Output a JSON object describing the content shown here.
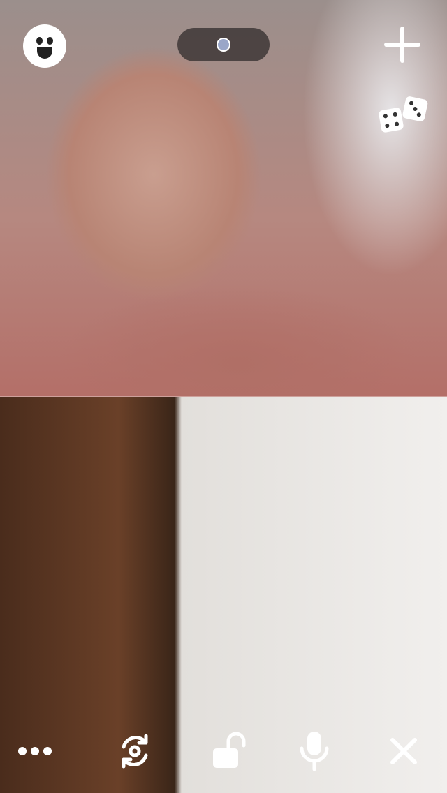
{
  "call": {
    "remote_label": "",
    "local_label": ""
  },
  "top_controls": {
    "face_icon": "emoji-face-icon",
    "camera_toggle_icon": "camera-toggle-icon",
    "add_icon": "plus-icon",
    "dice_icon": "dice-icon"
  },
  "bottom_controls": {
    "more_icon": "more-dots-icon",
    "flip_icon": "flip-camera-icon",
    "lock_icon": "unlock-icon",
    "mic_icon": "microphone-icon",
    "close_icon": "close-icon"
  },
  "colors": {
    "icon": "#ffffff",
    "pill_background": "#2d2828",
    "pill_dot": "#9aa6c8"
  }
}
